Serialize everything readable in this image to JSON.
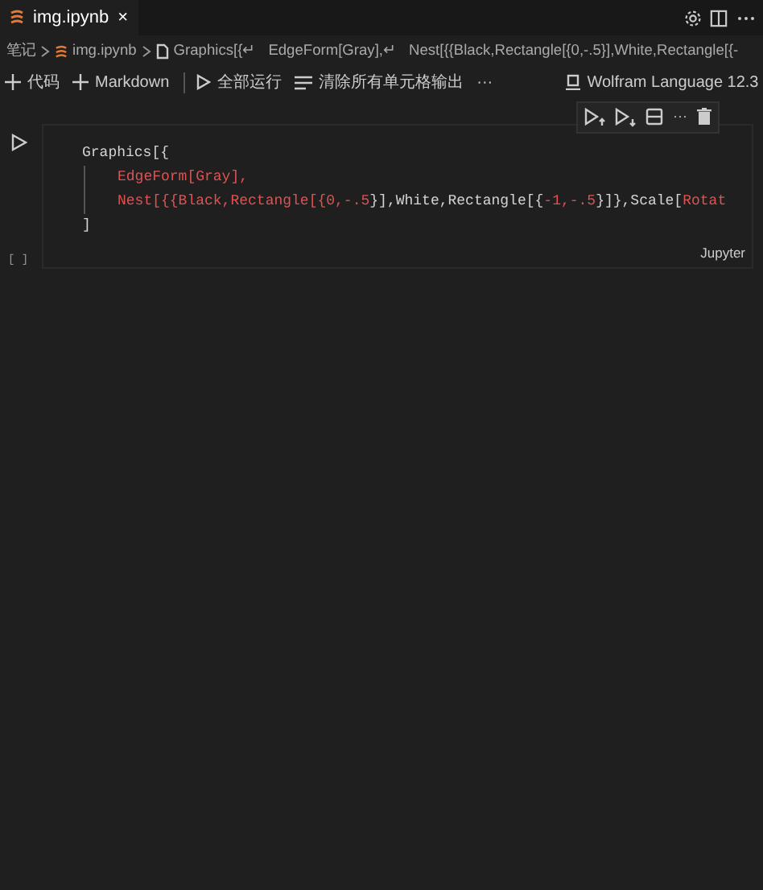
{
  "tab": {
    "title": "img.ipynb",
    "close": "×"
  },
  "breadcrumb": [
    "笔记",
    "img.ipynb",
    "Graphics[{↵",
    "EdgeForm[Gray],↵",
    "Nest[{{Black,Rectangle[{0,-.5}],White,Rectangle[{-"
  ],
  "toolbar": [
    {
      "kind": "plus",
      "label": "代码"
    },
    {
      "kind": "plus",
      "label": "Markdown"
    },
    {
      "kind": "run",
      "label": "全部运行"
    },
    {
      "kind": "clear",
      "label": "清除所有单元格输出"
    },
    {
      "kind": "more",
      "label": "···"
    }
  ],
  "kernel": "Wolfram Language 12.3",
  "cell": {
    "exec_count": "[ ]",
    "language": "Jupyter",
    "more": "···",
    "lines": [
      [
        {
          "kind": "plain",
          "text": "Graphics[{"
        }
      ],
      [
        {
          "kind": "red",
          "text": "EdgeForm[Gray],"
        }
      ],
      [
        {
          "kind": "red",
          "text": "Nest[{{Black,Rectangle[{0,-.5"
        },
        {
          "kind": "plain",
          "text": "}],White,Rectangle[{"
        },
        {
          "kind": "red",
          "text": "-1,-.5"
        },
        {
          "kind": "plain",
          "text": "}]},Scale["
        },
        {
          "kind": "red",
          "text": "Rotat"
        }
      ],
      [
        {
          "kind": "plain",
          "text": "]"
        }
      ]
    ]
  }
}
